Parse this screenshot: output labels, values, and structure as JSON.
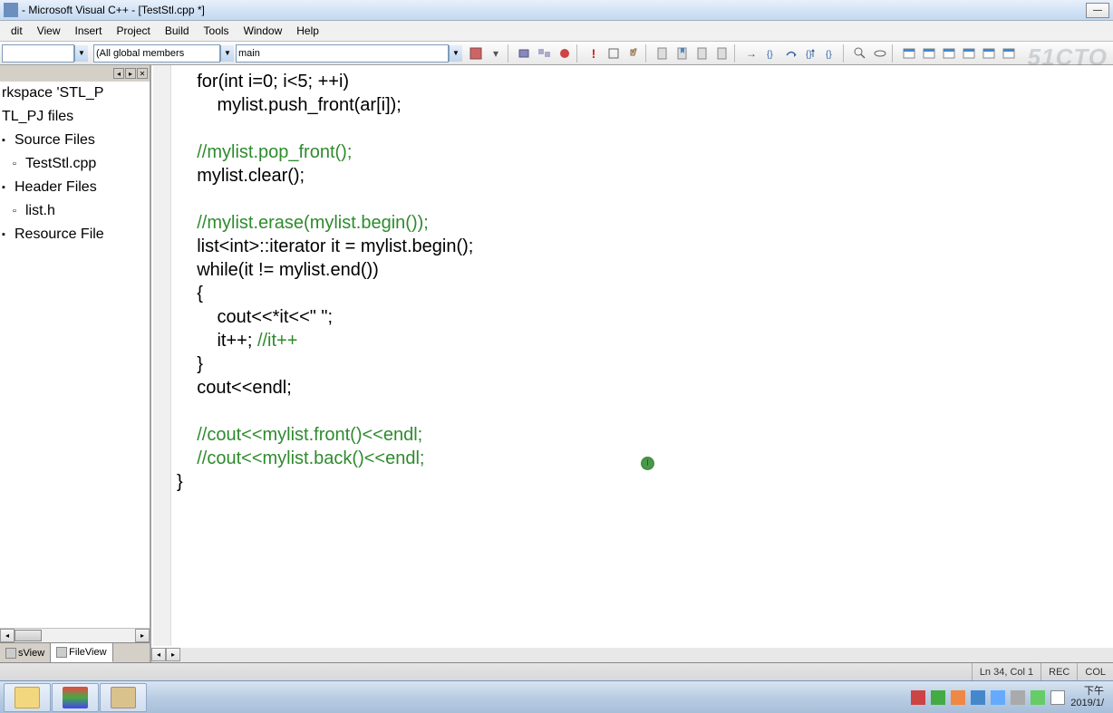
{
  "window": {
    "title": "- Microsoft Visual C++ - [TestStl.cpp *]"
  },
  "menu": {
    "items": [
      "dit",
      "View",
      "Insert",
      "Project",
      "Build",
      "Tools",
      "Window",
      "Help"
    ]
  },
  "toolbar": {
    "dd1": "",
    "dd2": "(All global members",
    "dd3": "main"
  },
  "workspace": {
    "root": "rkspace 'STL_P",
    "project": "TL_PJ files",
    "source_folder": "Source Files",
    "source_file": "TestStl.cpp",
    "header_folder": "Header Files",
    "header_file": "list.h",
    "resource_folder": "Resource File"
  },
  "sidebar_tabs": {
    "left": "sView",
    "right": "FileView"
  },
  "code": {
    "l1": "    for(int i=0; i<5; ++i)",
    "l2": "        mylist.push_front(ar[i]);",
    "l3": "",
    "l4": "    //mylist.pop_front();",
    "l5": "    mylist.clear();",
    "l6": "",
    "l7": "    //mylist.erase(mylist.begin());",
    "l8": "    list<int>::iterator it = mylist.begin();",
    "l9": "    while(it != mylist.end())",
    "l10": "    {",
    "l11": "        cout<<*it<<\" \";",
    "l12": "        it++; //it++",
    "l13": "    }",
    "l14": "    cout<<endl;",
    "l15": "",
    "l16": "    //cout<<mylist.front()<<endl;",
    "l17": "    //cout<<mylist.back()<<endl;",
    "l18": "}",
    "l19": ""
  },
  "status": {
    "pos": "Ln 34, Col 1",
    "rec": "REC",
    "col": "COL"
  },
  "tray": {
    "time": "下午",
    "date": "2019/1/"
  },
  "watermark": "51CTO"
}
